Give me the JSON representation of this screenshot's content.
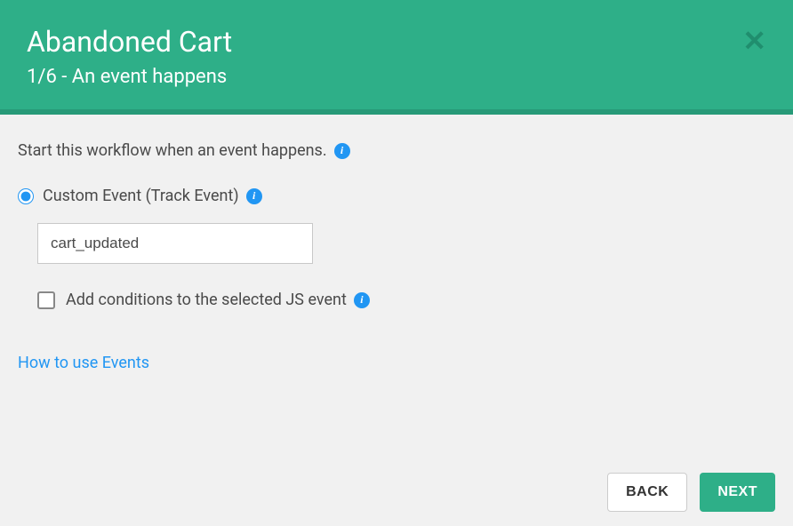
{
  "header": {
    "title": "Abandoned Cart",
    "subtitle": "1/6 - An event happens"
  },
  "content": {
    "intro": "Start this workflow when an event happens.",
    "customEventLabel": "Custom Event (Track Event)",
    "eventInputValue": "cart_updated",
    "addConditionsLabel": "Add conditions to the selected JS event",
    "helpLink": "How to use Events"
  },
  "footer": {
    "backLabel": "BACK",
    "nextLabel": "NEXT"
  }
}
